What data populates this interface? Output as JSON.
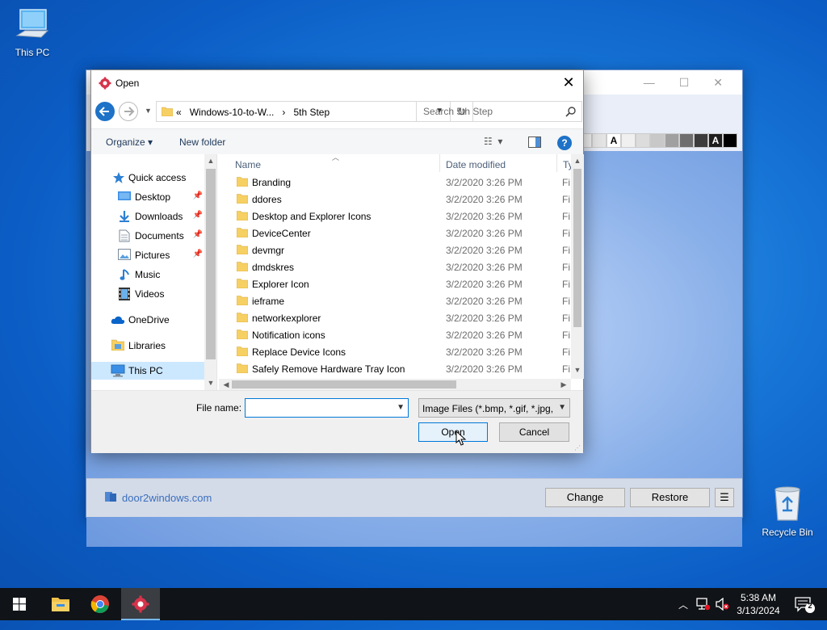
{
  "desktop": {
    "this_pc_label": "This PC",
    "recycle_bin_label": "Recycle Bin"
  },
  "background_app": {
    "brand": "door2windows.com",
    "change_label": "Change",
    "restore_label": "Restore",
    "swatch_letter": "A"
  },
  "dialog": {
    "title": "Open",
    "breadcrumb": [
      "«",
      "Windows-10-to-W...",
      "›",
      "5th Step"
    ],
    "search_placeholder": "Search 5th Step",
    "toolbar": {
      "organize": "Organize ▾",
      "new_folder": "New folder"
    },
    "nav_items": [
      {
        "label": "Quick access",
        "icon": "star-icon",
        "pinned": false
      },
      {
        "label": "Desktop",
        "icon": "desktop-folder-icon",
        "pinned": true
      },
      {
        "label": "Downloads",
        "icon": "downloads-icon",
        "pinned": true
      },
      {
        "label": "Documents",
        "icon": "documents-icon",
        "pinned": true
      },
      {
        "label": "Pictures",
        "icon": "pictures-icon",
        "pinned": true
      },
      {
        "label": "Music",
        "icon": "music-icon",
        "pinned": false
      },
      {
        "label": "Videos",
        "icon": "videos-icon",
        "pinned": false
      },
      {
        "label": "OneDrive",
        "icon": "onedrive-icon",
        "pinned": false
      },
      {
        "label": "Libraries",
        "icon": "libraries-icon",
        "pinned": false
      },
      {
        "label": "This PC",
        "icon": "computer-icon",
        "pinned": false
      }
    ],
    "columns": {
      "name": "Name",
      "date_modified": "Date modified",
      "type": "Ty"
    },
    "files": [
      {
        "name": "Branding",
        "date": "3/2/2020 3:26 PM",
        "type": "Fi"
      },
      {
        "name": "ddores",
        "date": "3/2/2020 3:26 PM",
        "type": "Fi"
      },
      {
        "name": "Desktop and Explorer Icons",
        "date": "3/2/2020 3:26 PM",
        "type": "Fi"
      },
      {
        "name": "DeviceCenter",
        "date": "3/2/2020 3:26 PM",
        "type": "Fi"
      },
      {
        "name": "devmgr",
        "date": "3/2/2020 3:26 PM",
        "type": "Fi"
      },
      {
        "name": "dmdskres",
        "date": "3/2/2020 3:26 PM",
        "type": "Fi"
      },
      {
        "name": "Explorer Icon",
        "date": "3/2/2020 3:26 PM",
        "type": "Fi"
      },
      {
        "name": "ieframe",
        "date": "3/2/2020 3:26 PM",
        "type": "Fi"
      },
      {
        "name": "networkexplorer",
        "date": "3/2/2020 3:26 PM",
        "type": "Fi"
      },
      {
        "name": "Notification icons",
        "date": "3/2/2020 3:26 PM",
        "type": "Fi"
      },
      {
        "name": "Replace Device Icons",
        "date": "3/2/2020 3:26 PM",
        "type": "Fi"
      },
      {
        "name": "Safely Remove Hardware Tray Icon",
        "date": "3/2/2020 3:26 PM",
        "type": "Fi"
      }
    ],
    "file_name_label": "File name:",
    "file_name_value": "",
    "file_type": "Image Files (*.bmp, *.gif, *.jpg,",
    "open_label": "Open",
    "cancel_label": "Cancel"
  },
  "taskbar": {
    "time": "5:38 AM",
    "date": "3/13/2024",
    "notification_count": "2"
  },
  "colors": {
    "accent": "#0078d7",
    "selection": "#cce8ff",
    "taskbar": "#101317",
    "folder": "#f7d063"
  }
}
